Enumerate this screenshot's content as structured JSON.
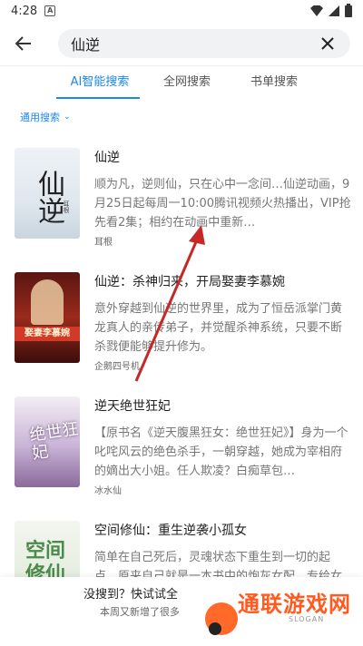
{
  "status_bar": {
    "time": "4:28",
    "app_icon": "a-icon"
  },
  "header": {
    "back_icon": "arrow-left-icon",
    "search_value": "仙逆",
    "clear_icon": "close-icon"
  },
  "tabs": [
    {
      "label": "AI智能搜索",
      "active": true
    },
    {
      "label": "全网搜索",
      "active": false
    },
    {
      "label": "书单搜索",
      "active": false
    }
  ],
  "filter": {
    "label": "通用搜索",
    "icon": "chevron-down-icon"
  },
  "results": [
    {
      "title": "仙逆",
      "desc": "顺为凡，逆则仙，只在心中一念间…仙逆动画，9月25日起每周一10:00腾讯视频火热播出，VIP抢先看2集；相约在动画中重新…",
      "author": "耳根",
      "cover_text": "仙逆",
      "cover_small": "耳根"
    },
    {
      "title": "仙逆：杀神归来，开局娶妻李慕婉",
      "desc": "意外穿越到仙逆的世界里，成为了恒岳派掌门黄龙真人的亲传弟子，并觉醒杀神系统，只要不断杀戮便能够提升修为。",
      "author": "企鹅四号机",
      "cover_text": "娶妻李慕婉"
    },
    {
      "title": "逆天绝世狂妃",
      "desc": "【原书名《逆天腹黑狂女：绝世狂妃》】身为一个叱咤风云的绝色杀手，一朝穿越，她成为宰相府的嫡出大小姐。任人欺凌？白痴草包…",
      "author": "冰水仙",
      "cover_text": "绝世狂妃"
    },
    {
      "title": "空间修仙：重生逆袭小孤女",
      "desc": "简单在自己死后，灵魂状态下重生到一切的起点，原来自己就是一本书中的炮灰女配，专给女主垫脚石砖铺路",
      "author": "",
      "cover_text": "空间修仙"
    }
  ],
  "banner": {
    "line1": "没搜到？快试试全",
    "line2": "本周又新增了很多"
  },
  "watermark": {
    "text": "通联游戏网",
    "slogan": "SLOGAN"
  },
  "colors": {
    "accent": "#1e88e5",
    "annotation_arrow": "#c62828"
  }
}
